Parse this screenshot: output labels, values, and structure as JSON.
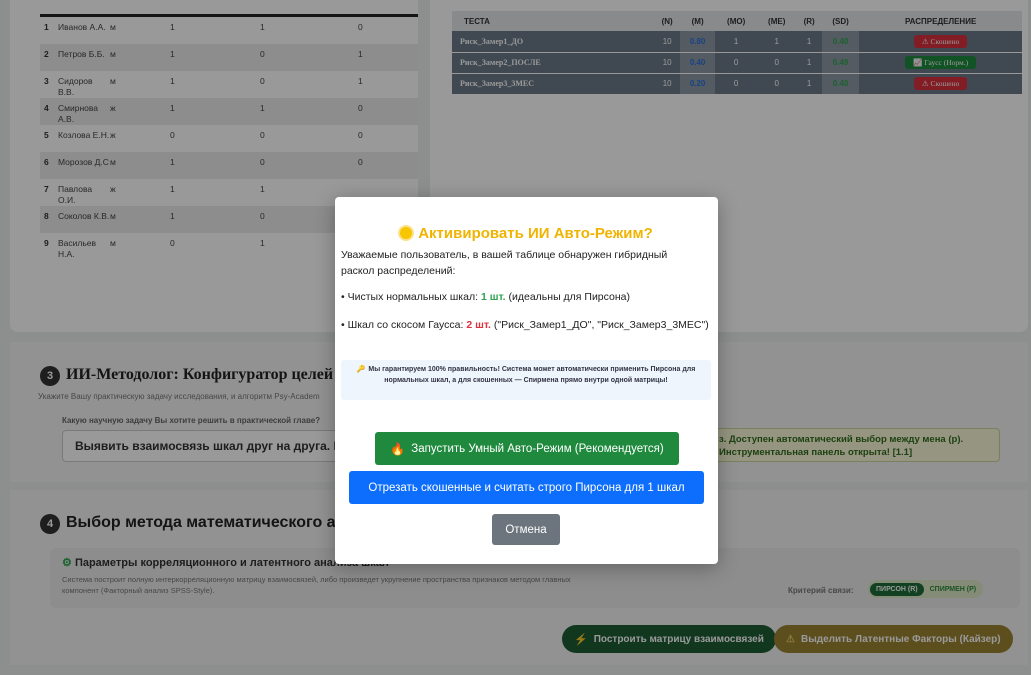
{
  "participants": [
    {
      "n": "1",
      "name": "Иванов А.А.",
      "sex": "м",
      "a": "1",
      "b": "1",
      "c": "0"
    },
    {
      "n": "2",
      "name": "Петров Б.Б.",
      "sex": "м",
      "a": "1",
      "b": "0",
      "c": "1"
    },
    {
      "n": "3",
      "name": "Сидоров В.В.",
      "sex": "м",
      "a": "1",
      "b": "0",
      "c": "1"
    },
    {
      "n": "4",
      "name": "Смирнова А.В.",
      "sex": "ж",
      "a": "1",
      "b": "1",
      "c": "0"
    },
    {
      "n": "5",
      "name": "Козлова Е.Н.",
      "sex": "ж",
      "a": "0",
      "b": "0",
      "c": "0"
    },
    {
      "n": "6",
      "name": "Морозов Д.С",
      "sex": "м",
      "a": "1",
      "b": "0",
      "c": "0"
    },
    {
      "n": "7",
      "name": "Павлова О.И.",
      "sex": "ж",
      "a": "1",
      "b": "1",
      "c": ""
    },
    {
      "n": "8",
      "name": "Соколов К.В.",
      "sex": "м",
      "a": "1",
      "b": "0",
      "c": ""
    },
    {
      "n": "9",
      "name": "Васильев Н.А.",
      "sex": "м",
      "a": "0",
      "b": "1",
      "c": ""
    }
  ],
  "stats": {
    "headers": [
      "ТЕСТА",
      "(N)",
      "(M)",
      "(MO)",
      "(ME)",
      "(R)",
      "(SD)",
      "РАСПРЕДЕЛЕНИЕ"
    ],
    "rows": [
      {
        "name": "Риск_Замер1_ДО",
        "n": "10",
        "m": "0.80",
        "mo": "1",
        "me": "1",
        "r": "1",
        "sd": "0.40",
        "dist": "⚠ Скошено",
        "dist_type": "red"
      },
      {
        "name": "Риск_Замер2_ПОСЛЕ",
        "n": "10",
        "m": "0.40",
        "mo": "0",
        "me": "0",
        "r": "1",
        "sd": "0.49",
        "dist": "📈 Гаусс (Норм.)",
        "dist_type": "green"
      },
      {
        "name": "Риск_Замер3_3МЕС",
        "n": "10",
        "m": "0.20",
        "mo": "0",
        "me": "0",
        "r": "1",
        "sd": "0.40",
        "dist": "⚠ Скошено",
        "dist_type": "red"
      }
    ]
  },
  "section3": {
    "number": "3",
    "title": "ИИ-Методолог: Конфигуратор целей и гипо",
    "subtitle": "Укажите Вашу практическую задачу исследования, и алгоритм Psy-Academ",
    "question": "Какую научную задачу Вы хотите решить в практической главе?",
    "input_value": "Выявить взаимосвязь шкал друг на друга. Коррел",
    "note": "з. Доступен автоматический выбор между мена (р). Инструментальная панель открыта! [1.1]"
  },
  "section4": {
    "number": "4",
    "title": "Выбор метода математического ана",
    "inner_title": "Параметры корреляционного и латентного анализа шкал",
    "inner_desc": "Система построит полную интеркорреляционную матрицу взаимосвязей, либо произведет укрупнение пространства признаков методом главных компонент (Факторный анализ SPSS-Style).",
    "criterion_label": "Критерий связи:",
    "toggle_on": "ПИРСОН (R)",
    "toggle_off": "СПИРМЕН (Р)",
    "btn_build": "Построить матрицу взаимосвязей",
    "btn_latent": "Выделить Латентные Факторы (Кайзер)"
  },
  "modal": {
    "title": "Активировать ИИ Авто-Режим?",
    "intro": "Уважаемые пользователь, в вашей таблице обнаружен гибридный раскол распределений:",
    "b1_pre": "• Чистых нормальных шкал: ",
    "b1_count": "1 шт.",
    "b1_post": " (идеальны для Пирсона)",
    "b2_pre": "• Шкал со скосом Гаусса: ",
    "b2_count": "2 шт.",
    "b2_post": " (\"Риск_Замер1_ДО\", \"Риск_Замер3_3МЕС\")",
    "guarantee": "Мы гарантируем 100% правильность! Система может автоматически применить Пирсона для нормальных шкал, а для скошенных — Спирмена прямо внутри одной матрицы!",
    "btn_smart": "Запустить Умный Авто-Режим (Рекомендуется)",
    "btn_cut": "Отрезать скошенные и считать строго Пирсона для 1 шкал",
    "btn_cancel": "Отмена"
  }
}
